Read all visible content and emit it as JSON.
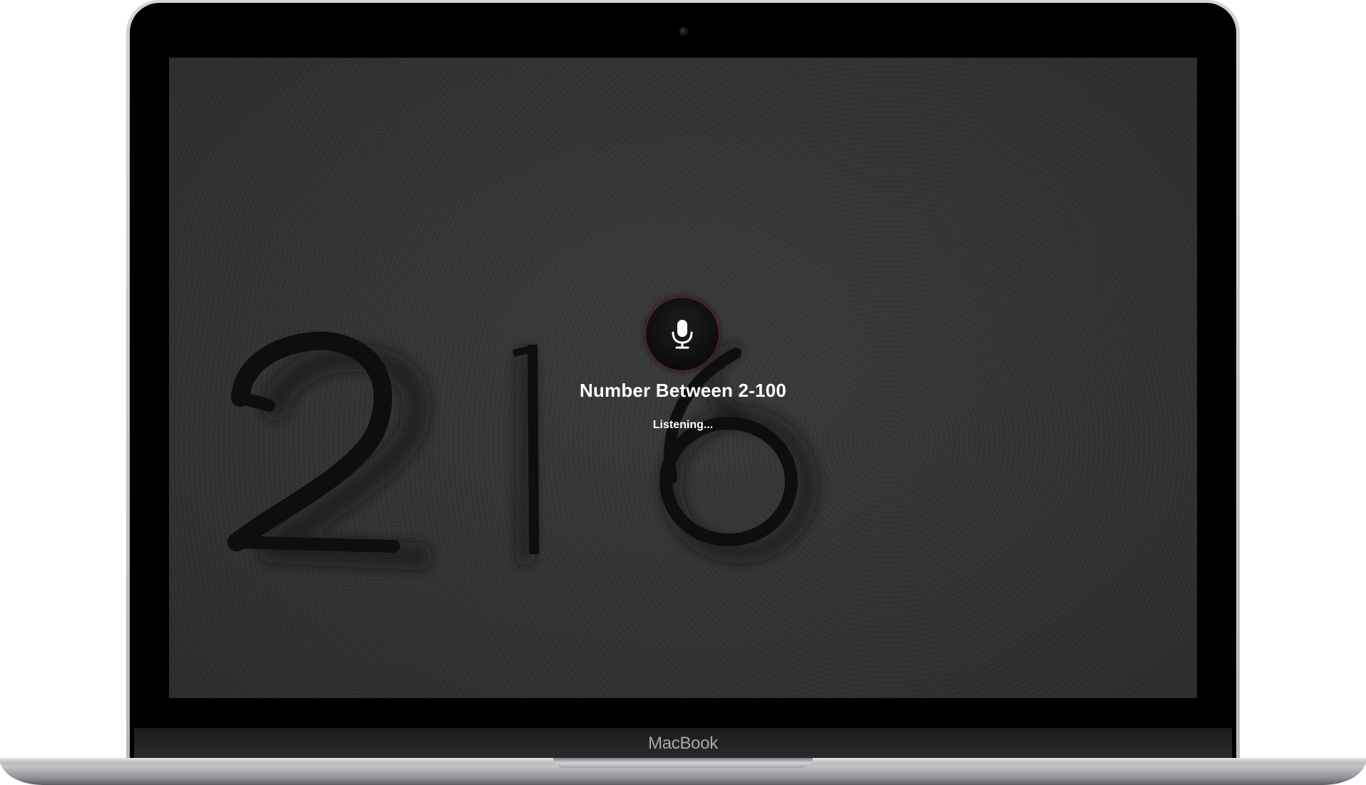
{
  "device": {
    "brand_label": "MacBook"
  },
  "screen": {
    "background_numerals": "216",
    "voice_prompt": {
      "title": "Number Between 2-100",
      "status": "Listening...",
      "icon": "microphone-icon",
      "ring_color": "#7a1f24"
    }
  }
}
